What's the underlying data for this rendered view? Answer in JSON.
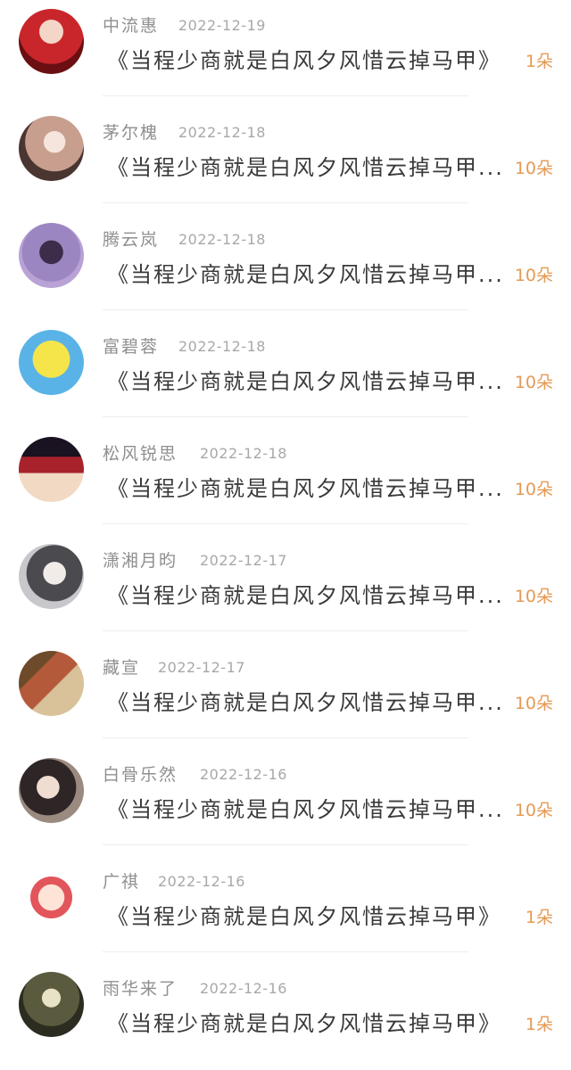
{
  "colors": {
    "name": "#8f8f8f",
    "date": "#a8a8a8",
    "gift_text": "#3a3a3a",
    "count": "#e59a55",
    "divider": "#ededed"
  },
  "rows": [
    {
      "name": "中流惠",
      "date": "2022-12-19",
      "gift": "《当程少商就是白风夕风惜云掉马甲》",
      "count": "1朵",
      "avatar": {
        "icon": "person-avatar",
        "bg": "radial-gradient(circle at 50% 35%, #f3d6c8 0 22%, #c9262b 23% 60%, #6b0f12 61%)"
      }
    },
    {
      "name": "茅尔槐",
      "date": "2022-12-18",
      "gift": "《当程少商就是白风夕风惜云掉马甲...",
      "count": "10朵",
      "avatar": {
        "icon": "person-avatar",
        "bg": "radial-gradient(circle at 55% 40%, #f6e5dd 0 20%, #c89f8e 21% 55%, #4a3530 56%)"
      }
    },
    {
      "name": "腾云岚",
      "date": "2022-12-18",
      "gift": "《当程少商就是白风夕风惜云掉马甲...",
      "count": "10朵",
      "avatar": {
        "icon": "person-avatar",
        "bg": "radial-gradient(circle at 50% 45%, #3d2c4a 0 24%, #9c86c2 25% 60%, #b8a2d6 61%)"
      }
    },
    {
      "name": "富碧蓉",
      "date": "2022-12-18",
      "gift": "《当程少商就是白风夕风惜云掉马甲...",
      "count": "10朵",
      "avatar": {
        "icon": "cartoon-avatar",
        "bg": "radial-gradient(circle at 50% 45%, #f5e44a 0 38%, #5ab3e6 39%)"
      }
    },
    {
      "name": "松风锐思",
      "date": "2022-12-18",
      "gift": "《当程少商就是白风夕风惜云掉马甲...",
      "count": "10朵",
      "avatar": {
        "icon": "person-avatar",
        "bg": "linear-gradient(180deg, #1a1220 0 30%, #a8222c 31% 55%, #f2d9c4 56%)"
      }
    },
    {
      "name": "潇湘月昀",
      "date": "2022-12-17",
      "gift": "《当程少商就是白风夕风惜云掉马甲...",
      "count": "10朵",
      "avatar": {
        "icon": "person-avatar",
        "bg": "radial-gradient(circle at 55% 45%, #f2ece8 0 22%, #4a4a4f 23% 55%, #c8c8cc 56%)"
      }
    },
    {
      "name": "藏宣",
      "date": "2022-12-17",
      "gift": "《当程少商就是白风夕风惜云掉马甲...",
      "count": "10朵",
      "avatar": {
        "icon": "photo-avatar",
        "bg": "linear-gradient(135deg, #6c4a2a 0 30%, #b45a3a 31% 55%, #d9c29a 56%)"
      }
    },
    {
      "name": "白骨乐然",
      "date": "2022-12-16",
      "gift": "《当程少商就是白风夕风惜云掉马甲...",
      "count": "10朵",
      "avatar": {
        "icon": "person-avatar",
        "bg": "radial-gradient(circle at 45% 45%, #f0ddd2 0 22%, #2e2626 23% 55%, #9b8a80 56%)"
      }
    },
    {
      "name": "广祺",
      "date": "2022-12-16",
      "gift": "《当程少商就是白风夕风惜云掉马甲》",
      "count": "1朵",
      "avatar": {
        "icon": "cartoon-avatar",
        "bg": "radial-gradient(circle at 50% 50%, #fde4d6 0 28%, #e2555b 29% 45%, #ffffff 46%)"
      }
    },
    {
      "name": "雨华来了",
      "date": "2022-12-16",
      "gift": "《当程少商就是白风夕风惜云掉马甲》",
      "count": "1朵",
      "avatar": {
        "icon": "person-avatar",
        "bg": "radial-gradient(circle at 50% 40%, #e8e2c6 0 18%, #5a5a3e 19% 55%, #2c2c20 56%)"
      }
    }
  ]
}
